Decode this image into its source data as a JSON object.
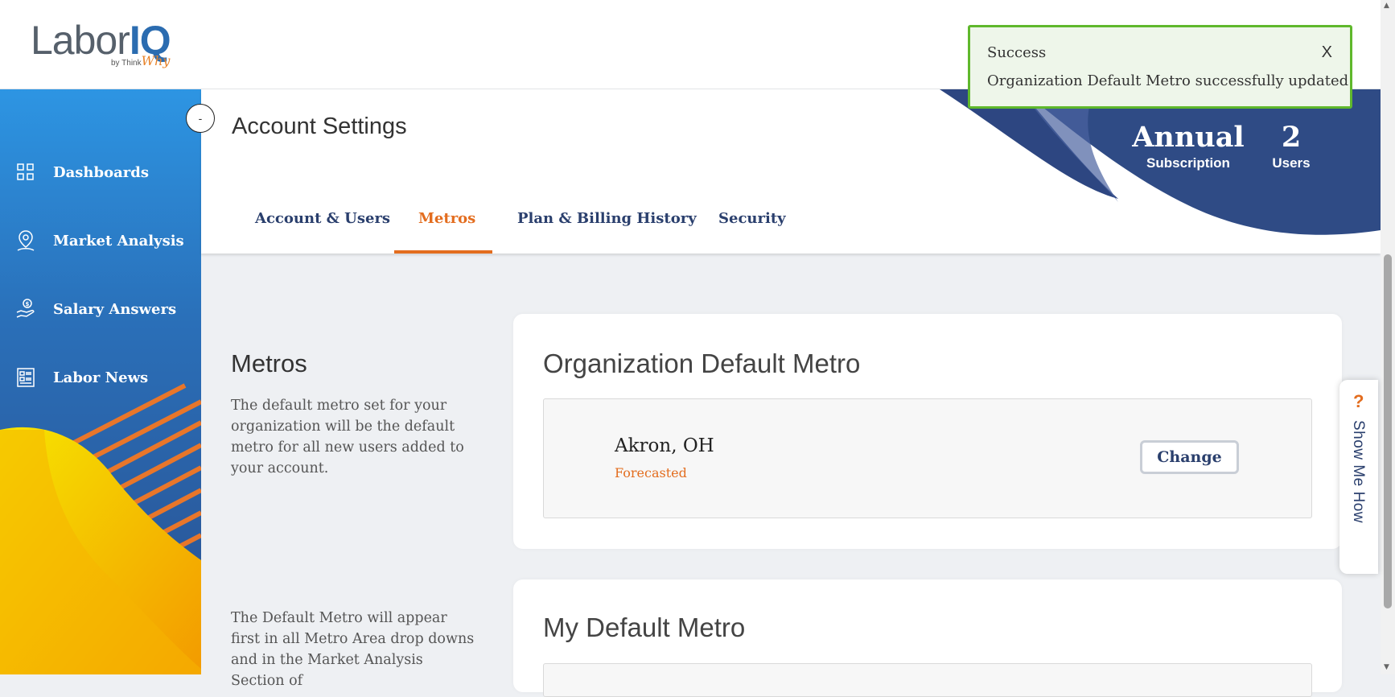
{
  "app": {
    "logo_main": "Labor",
    "logo_accent": "IQ",
    "logo_by": "by Think",
    "logo_by_accent": "Why"
  },
  "sidebar": {
    "collapse_label": "-",
    "items": [
      {
        "label": "Dashboards",
        "icon": "grid-icon"
      },
      {
        "label": "Market Analysis",
        "icon": "map-pin-icon"
      },
      {
        "label": "Salary Answers",
        "icon": "hand-dollar-icon"
      },
      {
        "label": "Labor News",
        "icon": "newspaper-icon"
      }
    ]
  },
  "header": {
    "title": "Account Settings",
    "tabs": [
      {
        "label": "Account & Users",
        "active": false
      },
      {
        "label": "Metros",
        "active": true
      },
      {
        "label": "Plan & Billing History",
        "active": false
      },
      {
        "label": "Security",
        "active": false
      }
    ],
    "stats": [
      {
        "value": "Annual",
        "label": "Subscription"
      },
      {
        "value": "2",
        "label": "Users"
      }
    ]
  },
  "toast": {
    "title": "Success",
    "message": "Organization Default Metro successfully updated",
    "close_label": "X"
  },
  "metros_section": {
    "title": "Metros",
    "description": "The default metro set for your organization will be the default metro for all new users added to your account.",
    "description2": "The Default Metro will appear first in all Metro Area drop downs and in the Market Analysis Section of"
  },
  "org_default_metro": {
    "title": "Organization Default Metro",
    "metro_name": "Akron, OH",
    "metro_status": "Forecasted",
    "change_label": "Change"
  },
  "my_default_metro": {
    "title": "My Default Metro"
  },
  "help": {
    "icon_label": "?",
    "label": "Show Me How"
  },
  "colors": {
    "accent_orange": "#e36d1f",
    "navy": "#2a3f6d",
    "toast_border": "#5fb82c",
    "sidebar_top": "#2d95e3",
    "sidebar_bottom": "#2a4f8f"
  }
}
